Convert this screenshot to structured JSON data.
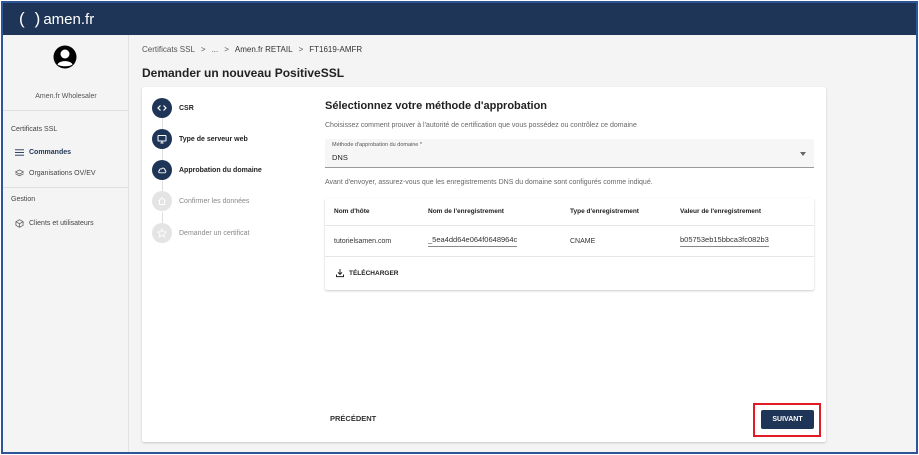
{
  "app": {
    "logo_text": "amen.fr"
  },
  "sidebar": {
    "account_name": "Amen.fr Wholesaler",
    "section_certificates": "Certificats SSL",
    "item_orders": "Commandes",
    "item_organizations": "Organisations OV/EV",
    "section_management": "Gestion",
    "item_clients": "Clients et utilisateurs"
  },
  "breadcrumb": {
    "item1": "Certificats SSL",
    "sep1": ">",
    "item2": "...",
    "sep2": ">",
    "item3": "Amen.fr RETAIL",
    "sep3": ">",
    "item4": "FT1619-AMFR"
  },
  "page": {
    "title": "Demander un nouveau PositiveSSL"
  },
  "steps": [
    {
      "label": "CSR",
      "icon": "code-icon",
      "state": "done"
    },
    {
      "label": "Type de serveur web",
      "icon": "monitor-icon",
      "state": "done"
    },
    {
      "label": "Approbation du domaine",
      "icon": "cloud-icon",
      "state": "active"
    },
    {
      "label": "Confirmer les données",
      "icon": "home-icon",
      "state": "pending"
    },
    {
      "label": "Demander un certificat",
      "icon": "star-icon",
      "state": "pending"
    }
  ],
  "approval": {
    "title": "Sélectionnez votre méthode d'approbation",
    "description": "Choisissez comment prouver à l'autorité de certification que vous possédez ou contrôlez ce domaine",
    "select_label": "Méthode d'approbation du domaine *",
    "select_value": "DNS",
    "note": "Avant d'envoyer, assurez-vous que les enregistrements DNS du domaine sont configurés comme indiqué.",
    "table": {
      "headers": [
        "Nom d'hôte",
        "Nom de l'enregistrement",
        "Type d'enregistrement",
        "Valeur de l'enregistrement"
      ],
      "row": {
        "host": "tutorielsamen.com",
        "record_name": "_5ea4dd64e064f0648964c",
        "record_type": "CNAME",
        "record_value": "b05753eb15bbca3fc082b3"
      }
    },
    "download_label": "TÉLÉCHARGER"
  },
  "actions": {
    "previous": "PRÉCÉDENT",
    "next": "SUIVANT"
  },
  "colors": {
    "navy": "#1e3557",
    "highlight": "#e31b23",
    "frame": "#2e5597"
  }
}
